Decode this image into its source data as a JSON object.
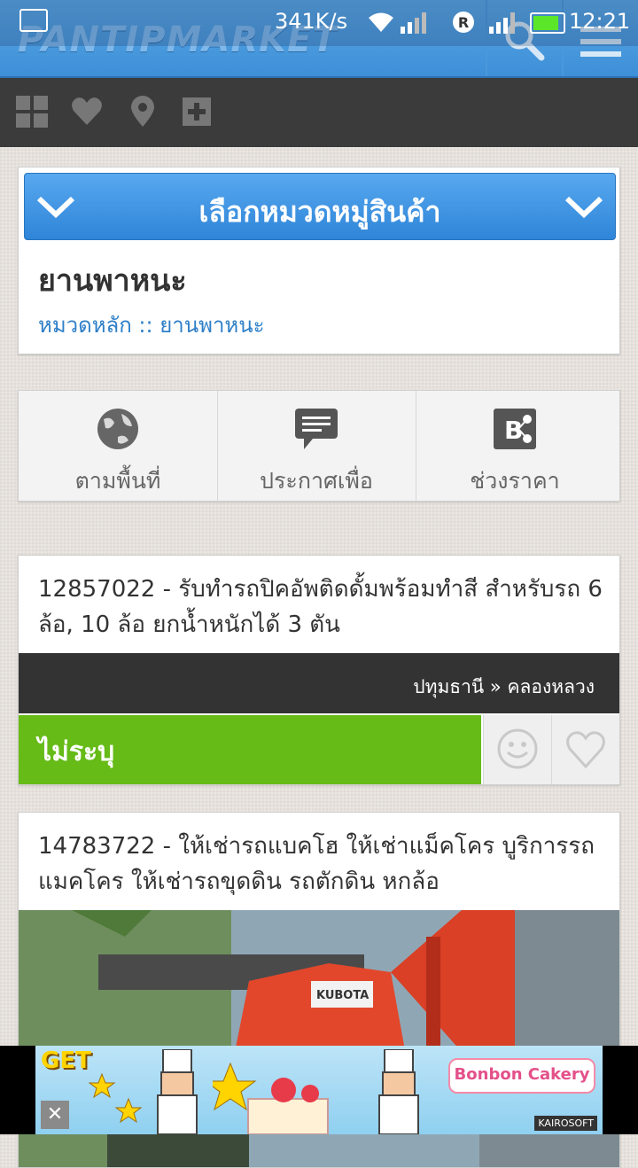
{
  "status_bar": {
    "net_speed": "341K/s",
    "time": "12:21"
  },
  "header": {
    "logo_text": "PANTIPMARKET",
    "icons": [
      "search-icon",
      "menu-icon"
    ]
  },
  "toolbar": {
    "icons": [
      "grid-icon",
      "heart-icon",
      "location-icon",
      "add-icon"
    ]
  },
  "category": {
    "button_label": "เลือกหมวดหมู่สินค้า",
    "title": "ยานพาหนะ",
    "breadcrumb": "หมวดหลัก :: ยานพาหนะ"
  },
  "filters": [
    {
      "label": "ตามพื้นที่",
      "icon": "globe-icon"
    },
    {
      "label": "ประกาศเพื่อ",
      "icon": "chat-icon"
    },
    {
      "label": "ช่วงราคา",
      "icon": "price-range-icon"
    }
  ],
  "listings": [
    {
      "title": "12857022 - รับทำรถปิคอัพติดดั้มพร้อมทำสี สำหรับรถ 6 ล้อ, 10 ล้อ ยกน้ำหนักได้ 3 ตัน",
      "location": "ปทุมธานี » คลองหลวง",
      "price": "ไม่ระบุ"
    },
    {
      "title": "14783722 - ให้เช่ารถแบคโฮ ให้เช่าแม็คโคร บูริการรถแมคโคร ให้เช่ารถขุดดิน รถตักดิน หกล้อ",
      "photo_label": "KUBOTA"
    }
  ],
  "ad": {
    "get_text": "GET",
    "brand_text": "Bonbon Cakery",
    "publisher": "KAIROSOFT",
    "close_label": "✕"
  },
  "colors": {
    "header_blue": "#3d8fd7",
    "price_green": "#66bb17",
    "link_blue": "#2e7fc8",
    "dark_bar": "#333333"
  }
}
